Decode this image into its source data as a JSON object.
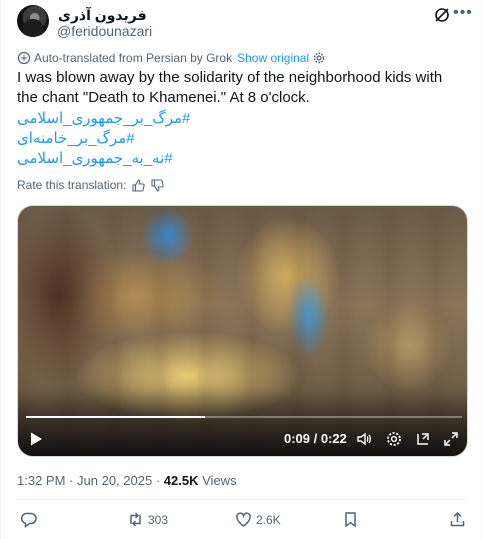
{
  "author": {
    "display_name": "فریدون آذری",
    "handle": "@feridounazari"
  },
  "translation": {
    "note": "Auto-translated from Persian by Grok",
    "show_original": "Show original"
  },
  "tweet": {
    "text": "I was blown away by the solidarity of the neighborhood kids with the chant \"Death to Khamenei.\" At 8 o'clock.",
    "hashtags": [
      "#مرگ_بر_جمهوری_اسلامی",
      "#مرگ_بر_خامنه‌ای",
      "#نه_به_جمهوری_اسلامی"
    ]
  },
  "rate": {
    "label": "Rate this translation:"
  },
  "video": {
    "time_display": "0:09 / 0:22",
    "progress": 0.41
  },
  "meta": {
    "time": "1:32 PM",
    "separator": "·",
    "date": "Jun 20, 2025",
    "views_count": "42.5K",
    "views_label": "Views"
  },
  "actions": {
    "replies": "",
    "reposts": "303",
    "likes": "2.6K"
  },
  "colors": {
    "accent": "#1d9bf0",
    "text": "#0f1419",
    "muted": "#536471"
  }
}
